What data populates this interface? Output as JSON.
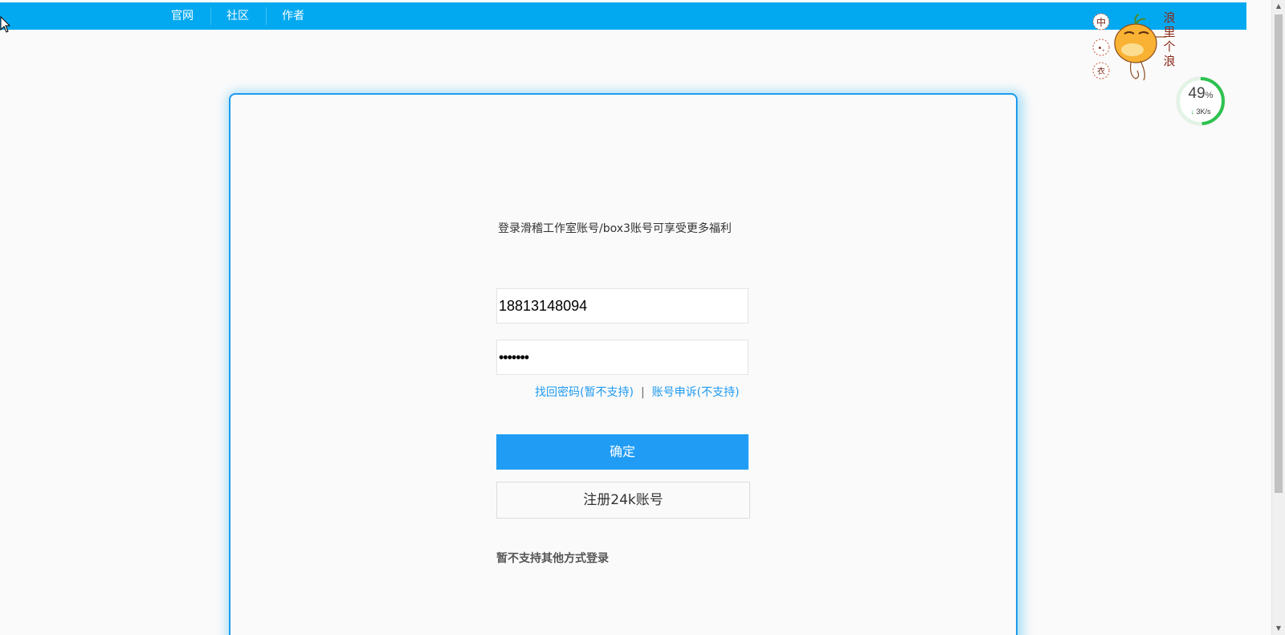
{
  "nav": {
    "items": [
      {
        "label": "官网"
      },
      {
        "label": "社区"
      },
      {
        "label": "作者"
      }
    ]
  },
  "login": {
    "subtitle": "登录滑稽工作室账号/box3账号可享受更多福利",
    "account_value": "18813148094",
    "password_value": "•••••••",
    "forgot_link": "找回密码(暂不支持)",
    "separator": "|",
    "appeal_link": "账号申诉(不支持)",
    "confirm_label": "确定",
    "register_label": "注册24k账号",
    "footnote": "暂不支持其他方式登录"
  },
  "widgets": {
    "mascot_text": [
      "浪",
      "里",
      "个",
      "浪"
    ],
    "mascot_buttons": [
      "中",
      "•,",
      "衣"
    ],
    "netmon": {
      "percent": "49",
      "percent_unit": "%",
      "speed": "3K/s",
      "ring_fraction": 0.49,
      "ring_color": "#2dc24f"
    }
  },
  "colors": {
    "topbar": "#03a9f0",
    "accent": "#209cf5",
    "link": "#1e9af0"
  }
}
